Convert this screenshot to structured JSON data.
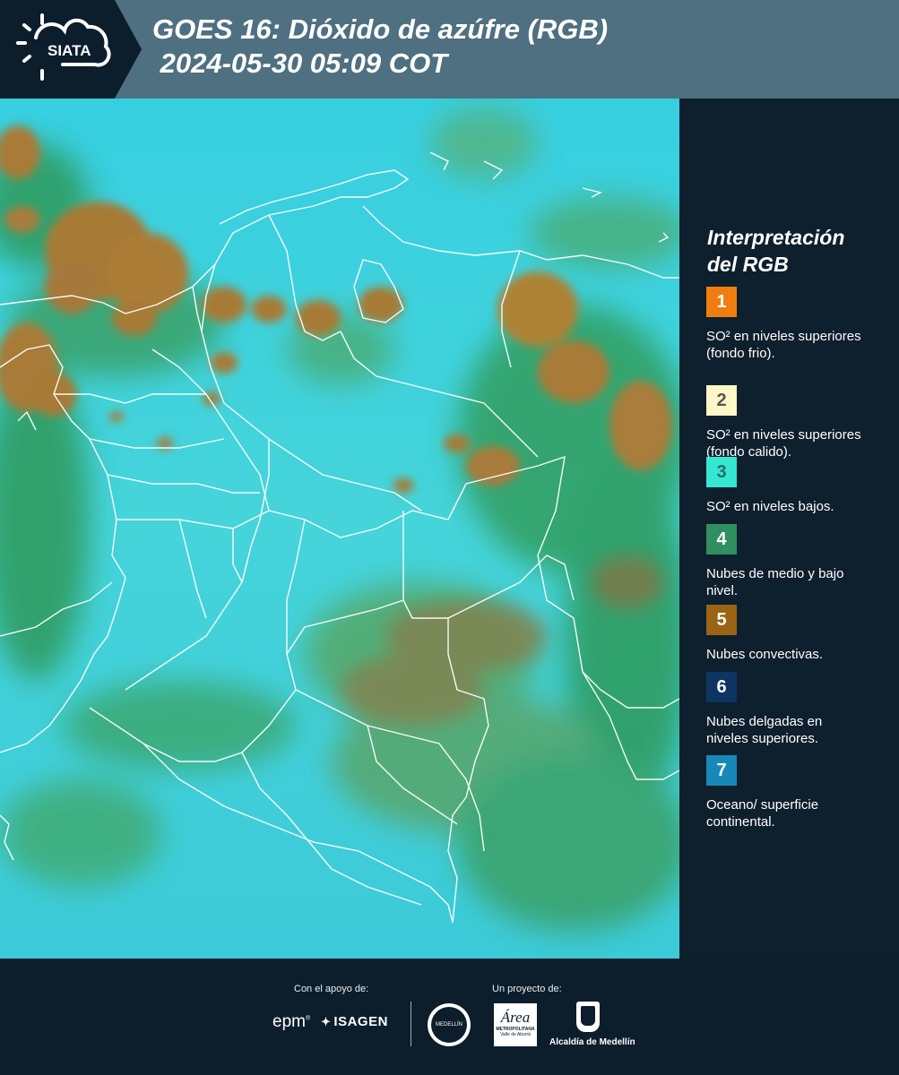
{
  "header": {
    "logo_text": "SIATA",
    "title_line1": "GOES 16: Dióxido de azúfre (RGB)",
    "title_line2": " 2024-05-30 05:09 COT"
  },
  "legend": {
    "title_line1": "Interpretación",
    "title_line2": "del RGB",
    "items": [
      {
        "number": "1",
        "text": "SO² en niveles superiores (fondo frio).",
        "color": "#f07d10",
        "num_color": "#ffffff"
      },
      {
        "number": "2",
        "text": "SO² en niveles superiores (fondo calido).",
        "color": "#fdf6c6",
        "num_color": "#555555"
      },
      {
        "number": "3",
        "text": "SO² en niveles bajos.",
        "color": "#35e6d1",
        "num_color": "#2a6e66"
      },
      {
        "number": "4",
        "text": "Nubes de medio y bajo nivel.",
        "color": "#2f8f61",
        "num_color": "#ffffff"
      },
      {
        "number": "5",
        "text": "Nubes convectivas.",
        "color": "#9a6414",
        "num_color": "#ffffff"
      },
      {
        "number": "6",
        "text": "Nubes delgadas en niveles superiores.",
        "color": "#0d3463",
        "num_color": "#ffffff"
      },
      {
        "number": "7",
        "text": "Oceano/ superficie continental.",
        "color": "#1689b8",
        "num_color": "#ffffff"
      }
    ]
  },
  "footer": {
    "support_label": "Con el apoyo de:",
    "project_label": "Un proyecto de:",
    "sponsor_epm": "epm",
    "sponsor_isagen": "ISAGEN",
    "area_text": "Área",
    "area_sub1": "METROPOLITANA",
    "area_sub2": "Valle de Aburrá",
    "alcaldia": "Alcaldía de Medellín",
    "seal_text": "MEDELLÍN"
  }
}
